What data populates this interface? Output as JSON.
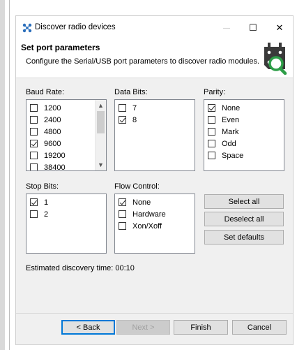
{
  "window": {
    "title": "Discover radio devices",
    "minimize_glyph": "—",
    "maximize_glyph": "☐",
    "close_glyph": "✕"
  },
  "header": {
    "title": "Set port parameters",
    "subtitle": "Configure the Serial/USB port parameters to discover radio modules.",
    "icon": "radio-search-icon",
    "accent": "#2e9e48"
  },
  "baud_rate": {
    "label": "Baud Rate:",
    "items": [
      {
        "label": "1200",
        "checked": false
      },
      {
        "label": "2400",
        "checked": false
      },
      {
        "label": "4800",
        "checked": false
      },
      {
        "label": "9600",
        "checked": true
      },
      {
        "label": "19200",
        "checked": false
      },
      {
        "label": "38400",
        "checked": false
      }
    ]
  },
  "data_bits": {
    "label": "Data Bits:",
    "items": [
      {
        "label": "7",
        "checked": false
      },
      {
        "label": "8",
        "checked": true
      }
    ]
  },
  "parity": {
    "label": "Parity:",
    "items": [
      {
        "label": "None",
        "checked": true
      },
      {
        "label": "Even",
        "checked": false
      },
      {
        "label": "Mark",
        "checked": false
      },
      {
        "label": "Odd",
        "checked": false
      },
      {
        "label": "Space",
        "checked": false
      }
    ]
  },
  "stop_bits": {
    "label": "Stop Bits:",
    "items": [
      {
        "label": "1",
        "checked": true
      },
      {
        "label": "2",
        "checked": false
      }
    ]
  },
  "flow_control": {
    "label": "Flow Control:",
    "items": [
      {
        "label": "None",
        "checked": true
      },
      {
        "label": "Hardware",
        "checked": false
      },
      {
        "label": "Xon/Xoff",
        "checked": false
      }
    ]
  },
  "actions": {
    "select_all": "Select all",
    "deselect_all": "Deselect all",
    "set_defaults": "Set defaults"
  },
  "estimate": "Estimated discovery time: 00:10",
  "footer": {
    "back": "< Back",
    "next": "Next >",
    "finish": "Finish",
    "cancel": "Cancel"
  }
}
